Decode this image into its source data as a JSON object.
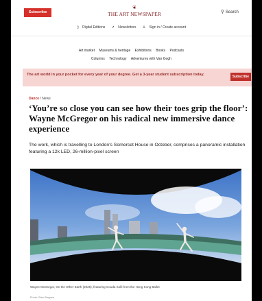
{
  "header": {
    "subscribe_label": "Subscribe",
    "logo_text": "THE ART NEWSPAPER",
    "search_label": "Search",
    "brand_color": "#d6302a"
  },
  "utility": {
    "digital_editions": "Digital Editions",
    "newsletters": "Newsletters",
    "sign_in": "Sign in / Create account"
  },
  "nav": {
    "row1": [
      "Art market",
      "Museums & heritage",
      "Exhibitions",
      "Books",
      "Podcasts"
    ],
    "row2": [
      "Columns",
      "Technology",
      "Adventures with Van Gogh"
    ]
  },
  "promo": {
    "text": "The art world in your pocket for every year of your degree. Get a 3-year student subscription today.",
    "button_label": "Subscribe",
    "background": "#f6d5d3"
  },
  "article": {
    "section": "Dance",
    "category": "News",
    "headline": "‘You’re so close you can see how their toes grip the floor’: Wayne McGregor on his radical new immersive dance experience",
    "standfirst": "The work, which is travelling to London’s Somerset House in October, comprises a panoramic installation featuring a 12k LED, 26-million-pixel screen",
    "caption": "Wayne McGregor, On the Other Earth (2025), featuring Gouda Solé from the Hong Kong Ballet",
    "credit": "Photo: Stan Staguea"
  }
}
